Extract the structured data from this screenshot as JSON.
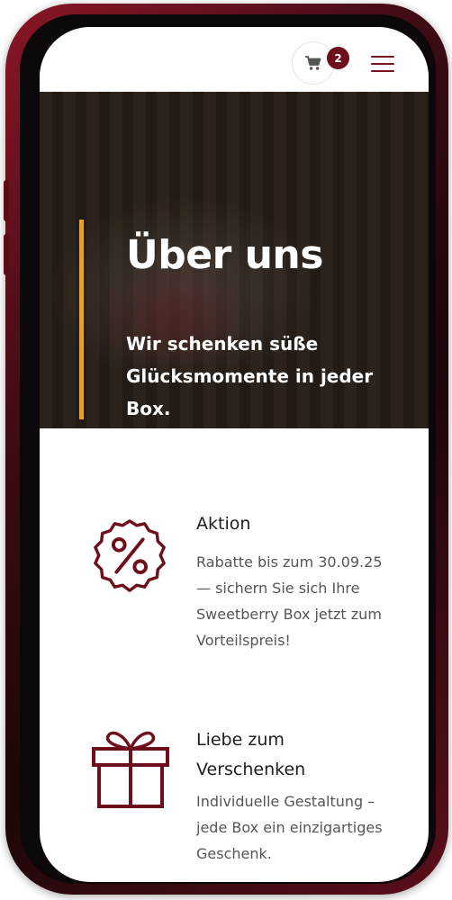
{
  "header": {
    "cart_count": "2",
    "icons": {
      "cart": "shopping-cart-icon",
      "menu": "hamburger-menu-icon"
    },
    "accent_color": "#6d0f1c"
  },
  "hero": {
    "title": "Über uns",
    "subtitle": "Wir schenken süße Glücksmomente in jeder Box.",
    "bar_color": "#e0a42a"
  },
  "features": [
    {
      "icon": "discount-badge-icon",
      "title": "Aktion",
      "text": "Rabatte bis zum 30.09.25 — sichern Sie sich Ihre Sweetberry Box jetzt zum Vorteilspreis!"
    },
    {
      "icon": "gift-box-icon",
      "title": "Liebe zum Verschenken",
      "text": "Individuelle Gestaltung – jede Box ein einzigartiges Geschenk."
    }
  ]
}
